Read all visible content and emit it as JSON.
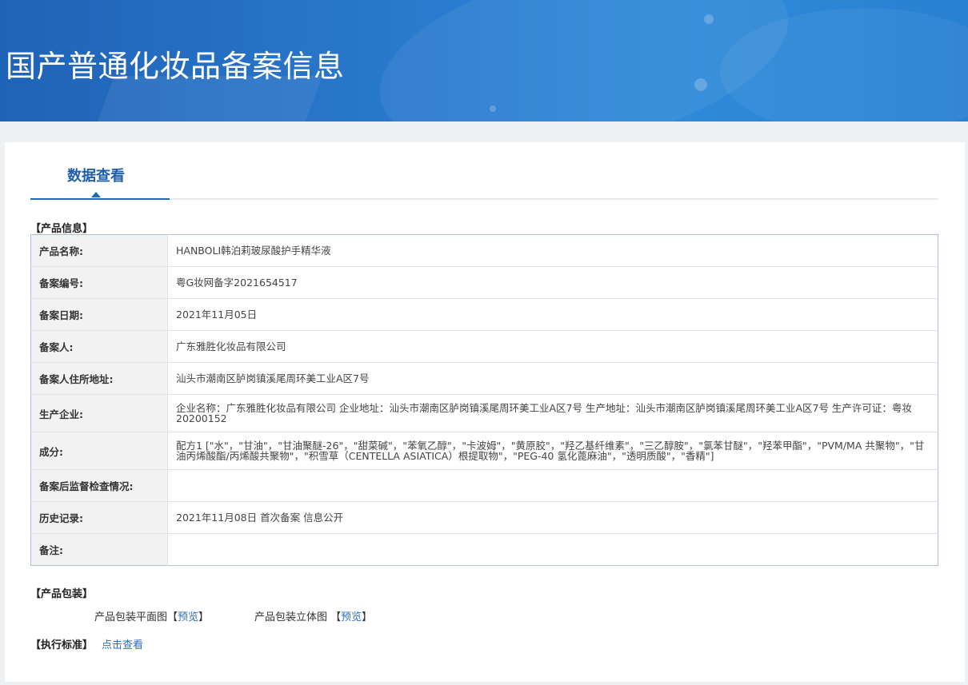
{
  "banner": {
    "title": "国产普通化妆品备案信息"
  },
  "tab": {
    "label": "数据查看"
  },
  "sections": {
    "product_info": "【产品信息】",
    "packaging": "【产品包装】",
    "standard": "【执行标准】"
  },
  "fields": [
    {
      "key": "产品名称:",
      "value": "HANBOLI韩泊莉玻尿酸护手精华液"
    },
    {
      "key": "备案编号:",
      "value": "粤G妆网备字2021654517"
    },
    {
      "key": "备案日期:",
      "value": "2021年11月05日"
    },
    {
      "key": "备案人:",
      "value": "广东雅胜化妆品有限公司"
    },
    {
      "key": "备案人住所地址:",
      "value": "汕头市潮南区胪岗镇溪尾周环美工业A区7号"
    },
    {
      "key": "生产企业:",
      "value": "企业名称：广东雅胜化妆品有限公司 企业地址：汕头市潮南区胪岗镇溪尾周环美工业A区7号 生产地址：汕头市潮南区胪岗镇溪尾周环美工业A区7号 生产许可证：粤妆20200152"
    },
    {
      "key": "成分:",
      "value": "配方1 [\"水\"，\"甘油\"，\"甘油聚醚-26\"，\"甜菜碱\"，\"苯氧乙醇\"，\"卡波姆\"，\"黄原胶\"，\"羟乙基纤维素\"，\"三乙醇胺\"，\"氯苯甘醚\"，\"羟苯甲酯\"，\"PVM/MA 共聚物\"，\"甘油丙烯酸酯/丙烯酸共聚物\"，\"积雪草（CENTELLA ASIATICA）根提取物\"，\"PEG-40 氢化蓖麻油\"，\"透明质酸\"，\"香精\"]"
    },
    {
      "key": "备案后监督检查情况:",
      "value": ""
    },
    {
      "key": "历史记录:",
      "value": "2021年11月08日 首次备案 信息公开"
    },
    {
      "key": "备注:",
      "value": ""
    }
  ],
  "packaging": {
    "flat_label": "产品包装平面图",
    "flat_bracket_open": "【",
    "flat_link": "预览",
    "flat_bracket_close": "】",
    "stereo_label": "产品包装立体图 ",
    "stereo_bracket_open": "【",
    "stereo_link": "预览",
    "stereo_bracket_close": "】"
  },
  "standard": {
    "link": "点击查看"
  }
}
